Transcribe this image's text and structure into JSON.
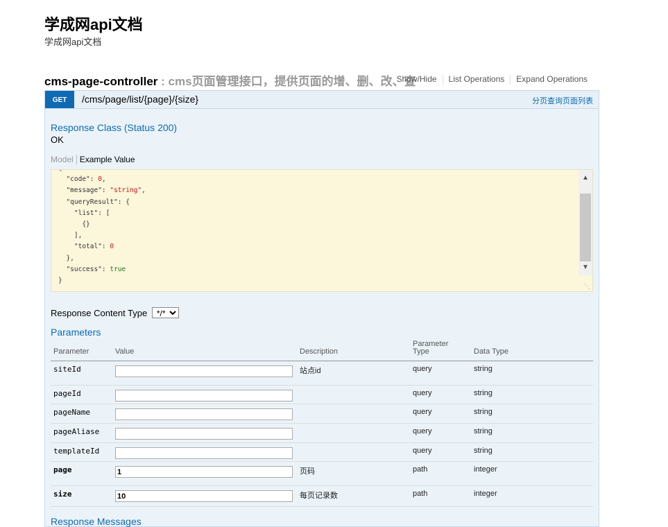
{
  "doc": {
    "title": "学成网api文档",
    "subtitle": "学成网api文档"
  },
  "controller": {
    "name": "cms-page-controller",
    "description": " : cms页面管理接口，提供页面的增、删、改、查",
    "links": [
      "Show/Hide",
      "List Operations",
      "Expand Operations"
    ]
  },
  "operation": {
    "method": "GET",
    "path": "/cms/page/list/{page}/{size}",
    "summary": "分页查询页面列表",
    "response_class_title": "Response Class (Status 200)",
    "response_class_value": "OK",
    "tab_model": "Model",
    "tab_example": "Example Value",
    "example_lines": [
      "{",
      "  \"code\": 0,",
      "  \"message\": \"string\",",
      "  \"queryResult\": {",
      "    \"list\": [",
      "      {}",
      "    ],",
      "    \"total\": 0",
      "  },",
      "  \"success\": true",
      "}"
    ],
    "response_content_type_label": "Response Content Type",
    "response_content_type_value": "*/*",
    "parameters_title": "Parameters",
    "param_headers": {
      "parameter": "Parameter",
      "value": "Value",
      "description": "Description",
      "parameter_type_line1": "Parameter",
      "parameter_type_line2": "Type",
      "data_type": "Data Type"
    },
    "params": [
      {
        "name": "siteId",
        "value": "",
        "description": "站点id",
        "type": "query",
        "data_type": "string",
        "required": false
      },
      {
        "name": "pageId",
        "value": "",
        "description": "",
        "type": "query",
        "data_type": "string",
        "required": false
      },
      {
        "name": "pageName",
        "value": "",
        "description": "",
        "type": "query",
        "data_type": "string",
        "required": false
      },
      {
        "name": "pageAliase",
        "value": "",
        "description": "",
        "type": "query",
        "data_type": "string",
        "required": false
      },
      {
        "name": "templateId",
        "value": "",
        "description": "",
        "type": "query",
        "data_type": "string",
        "required": false
      },
      {
        "name": "page",
        "value": "1",
        "description": "页码",
        "type": "path",
        "data_type": "integer",
        "required": true
      },
      {
        "name": "size",
        "value": "10",
        "description": "每页记录数",
        "type": "path",
        "data_type": "integer",
        "required": true
      }
    ],
    "response_messages_title": "Response Messages"
  },
  "colors": {
    "method_get": "#0f6ab4",
    "operation_bg": "#ebf3f9",
    "example_bg": "#fcf6db"
  },
  "icons": {
    "scroll_up": "chevron-up-icon",
    "scroll_down": "chevron-down-icon",
    "resize": "resize-grip-icon"
  }
}
